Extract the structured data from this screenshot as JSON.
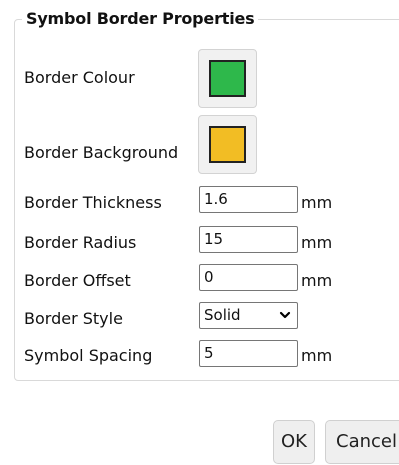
{
  "section": {
    "title": "Symbol Border Properties"
  },
  "fields": {
    "border_colour": {
      "label": "Border Colour",
      "color": "#2eb84b"
    },
    "border_background": {
      "label": "Border Background",
      "color": "#f2bd24"
    },
    "border_thickness": {
      "label": "Border Thickness",
      "value": "1.6",
      "unit": "mm"
    },
    "border_radius": {
      "label": "Border Radius",
      "value": "15",
      "unit": "mm"
    },
    "border_offset": {
      "label": "Border Offset",
      "value": "0",
      "unit": "mm"
    },
    "border_style": {
      "label": "Border Style",
      "selected": "Solid"
    },
    "symbol_spacing": {
      "label": "Symbol Spacing",
      "value": "5",
      "unit": "mm"
    }
  },
  "buttons": {
    "ok": "OK",
    "cancel": "Cancel"
  },
  "icons": {
    "dropdown": "chevron-down-icon"
  }
}
